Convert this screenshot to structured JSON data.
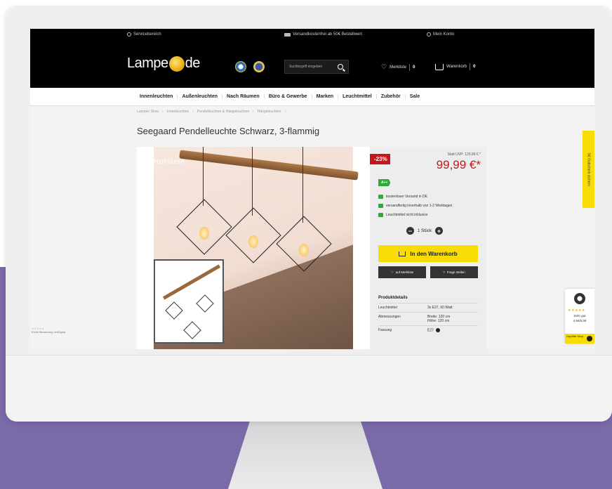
{
  "topbar": {
    "service": "Servicebereich",
    "shipping": "Versandkostenfrei ab 50€ Bestellwert",
    "account": "Mein Konto"
  },
  "header": {
    "logo_left": "Lampe",
    "logo_right": "de",
    "search_placeholder": "Suchbegriff eingeben",
    "wishlist_label": "Merkliste",
    "wishlist_count": "0",
    "cart_label": "Warenkorb",
    "cart_count": "0"
  },
  "nav": {
    "items": [
      "Innenleuchten",
      "Außenleuchten",
      "Nach Räumen",
      "Büro & Gewerbe",
      "Marken",
      "Leuchtmittel",
      "Zubehör",
      "Sale"
    ]
  },
  "breadcrumb": {
    "items": [
      "Lampen Shop",
      "Innenleuchten",
      "Pendelleuchten & Hängeleuchten",
      "Hängeleuchten"
    ]
  },
  "product": {
    "title": "Seegaard Pendelleuchte Schwarz, 3-flammig",
    "image_badge": "Hofstein",
    "discount": "-23%",
    "old_price": "Statt UVP: 129,99 € *",
    "price": "99,99 €*",
    "energy": "A++",
    "features": [
      "kostenloser Versand in DE",
      "versandfertig innerhalb von 1-2 Werktagen",
      "Leuchtmittel nicht inklusive"
    ],
    "qty": "1 Stück",
    "add_to_cart": "In den Warenkorb",
    "wishlist_btn": "auf Merkliste",
    "question_btn": "Frage stellen",
    "details_title": "Produktdetails",
    "details": [
      {
        "k": "Leuchtmittel",
        "v": "3x E27, 60 Watt"
      },
      {
        "k": "Abmessungen",
        "v": "Breite: 120 cm\nHöhe: 120 cm"
      },
      {
        "k": "Fassung",
        "v": "E27"
      }
    ]
  },
  "sidebar_tab": "5€ Gutschein sichern",
  "trust_widget": {
    "stars": "★★★★★",
    "rating_text": "Sehr gut",
    "score": "4,94/5.00",
    "footer": "Geprüfter Shop"
  },
  "left_rating": {
    "stars": "★★★★★",
    "text": "Keine Bewertung verfügbar"
  }
}
